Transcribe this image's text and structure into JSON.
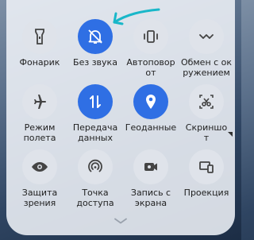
{
  "quick_settings": {
    "tiles": [
      {
        "id": "flashlight",
        "label": "Фонарик",
        "icon": "flashlight-icon",
        "active": false
      },
      {
        "id": "silent",
        "label": "Без звука",
        "icon": "bell-off-icon",
        "active": true
      },
      {
        "id": "autorotate",
        "label": "Автоповор\nот",
        "icon": "rotate-icon",
        "active": false
      },
      {
        "id": "nearby-share",
        "label": "Обмен с ок\nружением",
        "icon": "nearby-share-icon",
        "active": false
      },
      {
        "id": "airplane",
        "label": "Режим\nполета",
        "icon": "airplane-icon",
        "active": false
      },
      {
        "id": "mobile-data",
        "label": "Передача\nданных",
        "icon": "data-transfer-icon",
        "active": true
      },
      {
        "id": "location",
        "label": "Геоданные",
        "icon": "location-pin-icon",
        "active": true
      },
      {
        "id": "screenshot",
        "label": "Скриншо\nт",
        "icon": "screenshot-scissors-icon",
        "active": false,
        "has_more": true
      },
      {
        "id": "eye-protection",
        "label": "Защита\nзрения",
        "icon": "eye-icon",
        "active": false
      },
      {
        "id": "hotspot",
        "label": "Точка\nдоступа",
        "icon": "hotspot-icon",
        "active": false
      },
      {
        "id": "screen-record",
        "label": "Запись с\nэкрана",
        "icon": "video-camera-icon",
        "active": false
      },
      {
        "id": "cast",
        "label": "Проекция",
        "icon": "cast-screen-icon",
        "active": false
      }
    ]
  },
  "colors": {
    "active": "#2f6fe4",
    "inactive": "#dfe3ea",
    "annotation_arrow": "#19b7c9"
  }
}
